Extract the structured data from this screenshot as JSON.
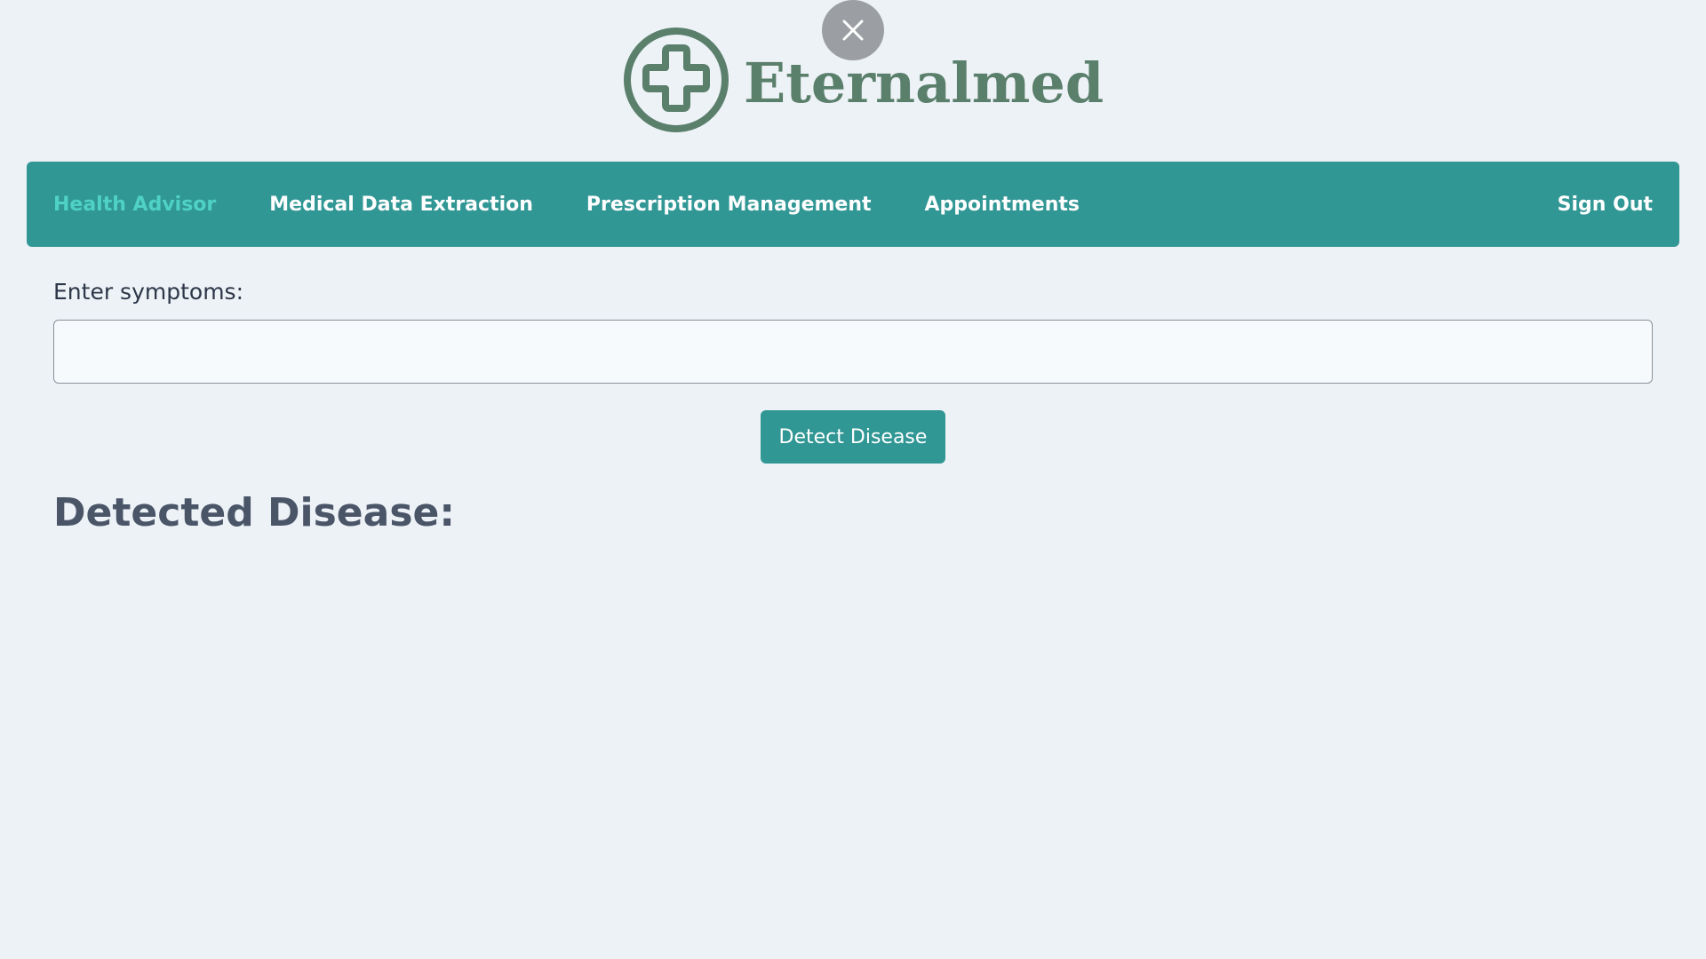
{
  "app": {
    "brand_name": "Eternalmed",
    "logo_icon": "medical-cross-icon",
    "close_icon": "close-icon"
  },
  "nav": {
    "items": [
      {
        "label": "Health Advisor",
        "active": true
      },
      {
        "label": "Medical Data Extraction",
        "active": false
      },
      {
        "label": "Prescription Management",
        "active": false
      },
      {
        "label": "Appointments",
        "active": false
      }
    ],
    "sign_out": "Sign Out"
  },
  "form": {
    "symptoms_label": "Enter symptoms:",
    "symptoms_value": "",
    "symptoms_placeholder": "",
    "detect_button": "Detect Disease"
  },
  "result": {
    "heading": "Detected Disease:"
  },
  "colors": {
    "background": "#edf2f7",
    "navbar": "#319795",
    "active_nav": "#4fd1c5",
    "brand": "#5a7f6b",
    "close_button": "#9b9ea2"
  }
}
